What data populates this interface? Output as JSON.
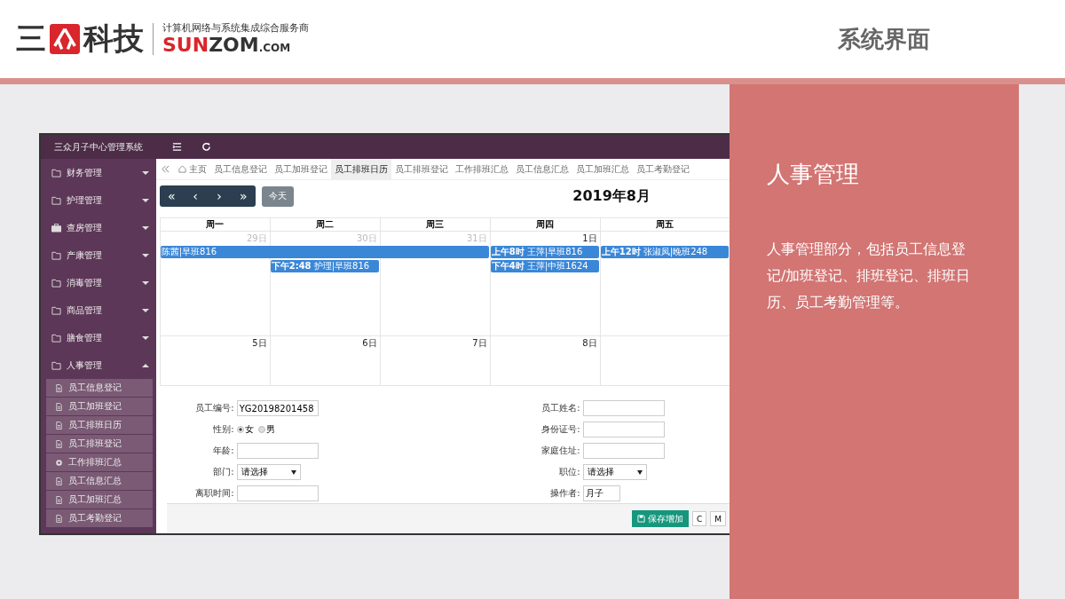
{
  "banner": {
    "logo": {
      "mark": "三",
      "word": "科技",
      "slogan": "计算机网络与系统集成综合服务商",
      "brand_red": "SUN",
      "brand_dark": "ZOM",
      "domain": ".COM"
    },
    "title": "系统界面"
  },
  "app": {
    "title": "三众月子中心管理系统",
    "sidebar": [
      {
        "label": "财务管理",
        "expanded": false
      },
      {
        "label": "护理管理",
        "expanded": false
      },
      {
        "label": "查房管理",
        "expanded": false
      },
      {
        "label": "产康管理",
        "expanded": false
      },
      {
        "label": "消毒管理",
        "expanded": false
      },
      {
        "label": "商品管理",
        "expanded": false
      },
      {
        "label": "膳食管理",
        "expanded": false
      },
      {
        "label": "人事管理",
        "expanded": true,
        "children": [
          {
            "label": "员工信息登记"
          },
          {
            "label": "员工加班登记"
          },
          {
            "label": "员工排班日历"
          },
          {
            "label": "员工排班登记"
          },
          {
            "label": "工作排班汇总"
          },
          {
            "label": "员工信息汇总"
          },
          {
            "label": "员工加班汇总"
          },
          {
            "label": "员工考勤登记"
          }
        ]
      }
    ],
    "tabs": [
      {
        "label": "主页",
        "selected": false
      },
      {
        "label": "员工信息登记",
        "selected": false
      },
      {
        "label": "员工加班登记",
        "selected": false
      },
      {
        "label": "员工排班日历",
        "selected": true
      },
      {
        "label": "员工排班登记",
        "selected": false
      },
      {
        "label": "工作排班汇总",
        "selected": false
      },
      {
        "label": "员工信息汇总",
        "selected": false
      },
      {
        "label": "员工加班汇总",
        "selected": false
      },
      {
        "label": "员工考勤登记",
        "selected": false
      }
    ],
    "calendar": {
      "nav": [
        "«",
        "‹",
        "›",
        "»"
      ],
      "today": "今天",
      "month": "2019年8月",
      "weekdays": [
        "周一",
        "周二",
        "周三",
        "周四",
        "周五"
      ],
      "weeks": [
        {
          "days": [
            {
              "label": "29日",
              "other_month": true
            },
            {
              "label": "30日",
              "other_month": true
            },
            {
              "label": "31日",
              "other_month": true
            },
            {
              "label": "1日",
              "other_month": false
            }
          ],
          "lanes": [
            [
              {
                "kind": "event",
                "text": "陈茜|早班816"
              },
              {
                "kind": "continued"
              },
              {
                "kind": "continued"
              },
              {
                "kind": "event",
                "text": "**上午8时** 王萍|早班816"
              },
              {
                "kind": "event",
                "text": "**上午12时** 张淑凤|晚班248"
              }
            ],
            [
              {
                "kind": "empty"
              },
              {
                "kind": "event",
                "text": "**下午2:48** 护理|早班816"
              },
              {
                "kind": "empty"
              },
              {
                "kind": "event",
                "text": "**下午4时** 王萍|中班1624"
              }
            ]
          ]
        },
        {
          "days": [
            {
              "label": "5日",
              "other_month": false
            },
            {
              "label": "6日",
              "other_month": false
            },
            {
              "label": "7日",
              "other_month": false
            },
            {
              "label": "8日",
              "other_month": false
            }
          ]
        }
      ]
    },
    "form": {
      "left": [
        {
          "kind": "text",
          "label": "员工编号:",
          "value": "YG20198201458"
        },
        {
          "kind": "radio",
          "label": "性别:",
          "options": [
            {
              "label": "女",
              "selected": true
            },
            {
              "label": "男",
              "selected": false
            }
          ]
        },
        {
          "kind": "text",
          "label": "年龄:"
        },
        {
          "kind": "select",
          "label": "部门:",
          "value": "请选择"
        },
        {
          "kind": "text",
          "label": "离职时间:"
        }
      ],
      "right": [
        {
          "kind": "text",
          "label": "员工姓名:"
        },
        {
          "kind": "text",
          "label": "身份证号:"
        },
        {
          "kind": "text",
          "label": "家庭住址:"
        },
        {
          "kind": "select",
          "label": "职位:",
          "value": "请选择"
        },
        {
          "kind": "short",
          "label": "操作者:",
          "value": "月子"
        }
      ],
      "buttons": [
        {
          "kind": "primary",
          "label": "保存增加"
        },
        {
          "kind": "small",
          "label": "C"
        },
        {
          "kind": "small",
          "label": "M"
        }
      ]
    }
  },
  "panel": {
    "title": "人事管理",
    "text": "人事管理部分，包括员工信息登记/加班登记、排班登记、排班日历、员工考勤管理等。"
  }
}
